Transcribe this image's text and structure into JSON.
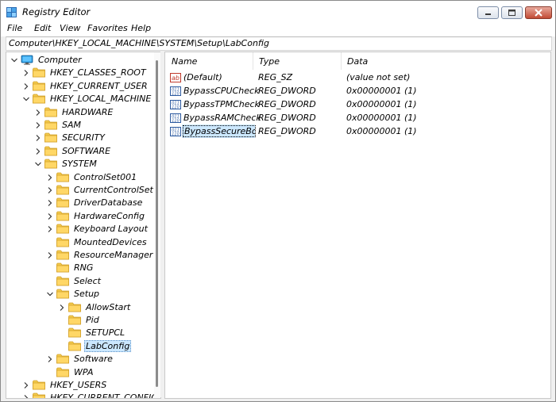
{
  "window": {
    "title": "Registry Editor",
    "accent_color": "#cce8ff",
    "close_button_color": "#c24a34"
  },
  "menu": [
    "File",
    "Edit",
    "View",
    "Favorites",
    "Help"
  ],
  "address": "Computer\\HKEY_LOCAL_MACHINE\\SYSTEM\\Setup\\LabConfig",
  "tree": [
    {
      "label": "Computer",
      "chevron": "down",
      "icon": "computer-icon",
      "selected": false
    },
    {
      "label": "HKEY_CLASSES_ROOT",
      "chevron": "right",
      "icon": "folder-icon",
      "selected": false
    },
    {
      "label": "HKEY_CURRENT_USER",
      "chevron": "right",
      "icon": "folder-icon",
      "selected": false
    },
    {
      "label": "HKEY_LOCAL_MACHINE",
      "chevron": "down",
      "icon": "folder-icon",
      "selected": false
    },
    {
      "label": "HARDWARE",
      "chevron": "right",
      "icon": "folder-icon",
      "selected": false
    },
    {
      "label": "SAM",
      "chevron": "right",
      "icon": "folder-icon",
      "selected": false
    },
    {
      "label": "SECURITY",
      "chevron": "right",
      "icon": "folder-icon",
      "selected": false
    },
    {
      "label": "SOFTWARE",
      "chevron": "right",
      "icon": "folder-icon",
      "selected": false
    },
    {
      "label": "SYSTEM",
      "chevron": "down",
      "icon": "folder-icon",
      "selected": false
    },
    {
      "label": "ControlSet001",
      "chevron": "right",
      "icon": "folder-icon",
      "selected": false
    },
    {
      "label": "CurrentControlSet",
      "chevron": "right",
      "icon": "folder-icon",
      "selected": false
    },
    {
      "label": "DriverDatabase",
      "chevron": "right",
      "icon": "folder-icon",
      "selected": false
    },
    {
      "label": "HardwareConfig",
      "chevron": "right",
      "icon": "folder-icon",
      "selected": false
    },
    {
      "label": "Keyboard Layout",
      "chevron": "right",
      "icon": "folder-icon",
      "selected": false
    },
    {
      "label": "MountedDevices",
      "chevron": "none",
      "icon": "folder-icon",
      "selected": false
    },
    {
      "label": "ResourceManager",
      "chevron": "right",
      "icon": "folder-icon",
      "selected": false
    },
    {
      "label": "RNG",
      "chevron": "none",
      "icon": "folder-icon",
      "selected": false
    },
    {
      "label": "Select",
      "chevron": "none",
      "icon": "folder-icon",
      "selected": false
    },
    {
      "label": "Setup",
      "chevron": "down",
      "icon": "folder-icon",
      "selected": false
    },
    {
      "label": "AllowStart",
      "chevron": "right",
      "icon": "folder-icon",
      "selected": false
    },
    {
      "label": "Pid",
      "chevron": "none",
      "icon": "folder-icon",
      "selected": false
    },
    {
      "label": "SETUPCL",
      "chevron": "none",
      "icon": "folder-icon",
      "selected": false
    },
    {
      "label": "LabConfig",
      "chevron": "none",
      "icon": "folder-icon",
      "selected": true
    },
    {
      "label": "Software",
      "chevron": "right",
      "icon": "folder-icon",
      "selected": false
    },
    {
      "label": "WPA",
      "chevron": "none",
      "icon": "folder-icon",
      "selected": false
    },
    {
      "label": "HKEY_USERS",
      "chevron": "right",
      "icon": "folder-icon",
      "selected": false
    },
    {
      "label": "HKEY_CURRENT_CONFIG",
      "chevron": "right",
      "icon": "folder-icon",
      "selected": false
    }
  ],
  "values_table": {
    "columns": [
      "Name",
      "Type",
      "Data"
    ],
    "rows": [
      {
        "name": "(Default)",
        "type": "REG_SZ",
        "data": "(value not set)",
        "icon": "string-value-icon",
        "focused": false
      },
      {
        "name": "BypassCPUCheck",
        "type": "REG_DWORD",
        "data": "0x00000001 (1)",
        "icon": "dword-value-icon",
        "focused": false
      },
      {
        "name": "BypassTPMCheck",
        "type": "REG_DWORD",
        "data": "0x00000001 (1)",
        "icon": "dword-value-icon",
        "focused": false
      },
      {
        "name": "BypassRAMCheck",
        "type": "REG_DWORD",
        "data": "0x00000001 (1)",
        "icon": "dword-value-icon",
        "focused": false
      },
      {
        "name": "BypassSecureBo...",
        "type": "REG_DWORD",
        "data": "0x00000001 (1)",
        "icon": "dword-value-icon",
        "focused": true
      }
    ]
  }
}
